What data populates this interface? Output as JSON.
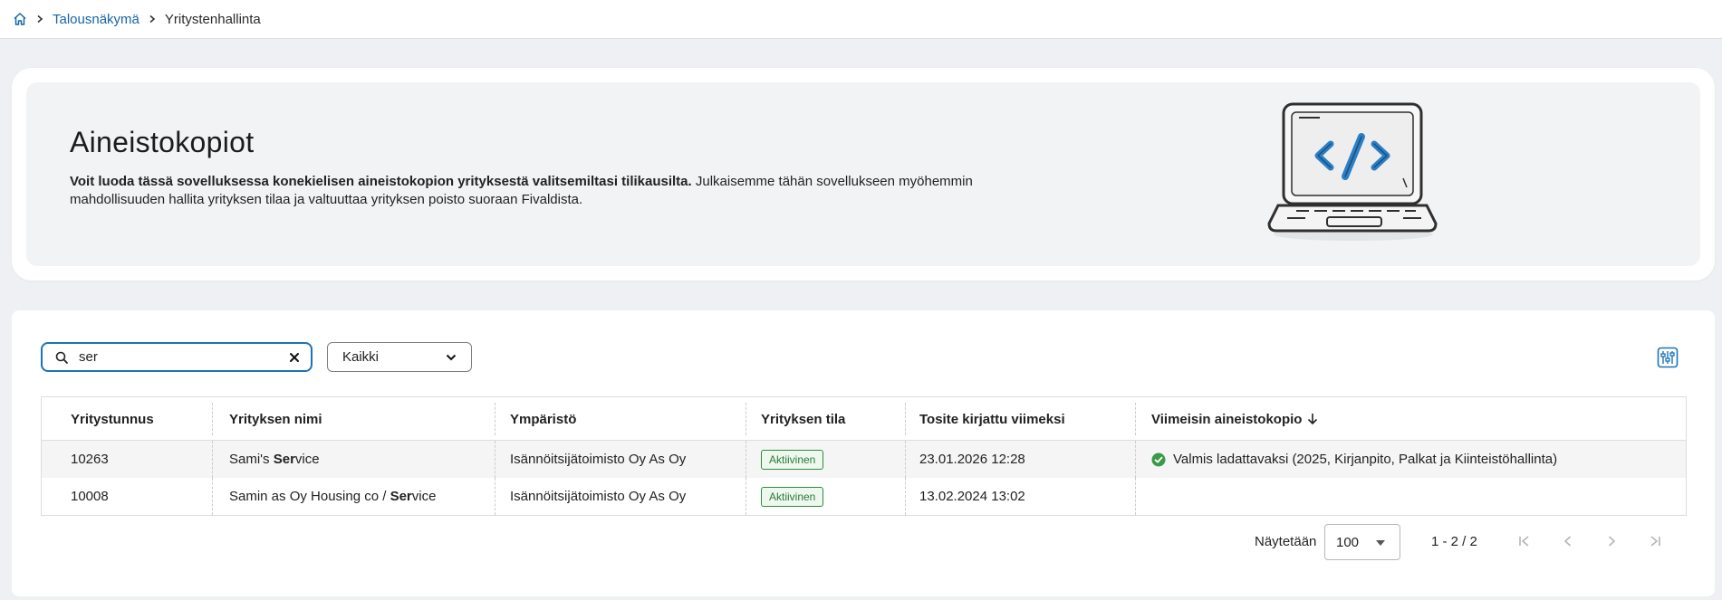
{
  "breadcrumb": {
    "home_icon": "home-icon",
    "items": [
      {
        "label": "Talousnäkymä"
      },
      {
        "label": "Yritystenhallinta"
      }
    ]
  },
  "hero": {
    "title": "Aineistokopiot",
    "description_bold": "Voit luoda tässä sovelluksessa konekielisen aineistokopion yrityksestä valitsemiltasi tilikausilta.",
    "description_rest": " Julkaisemme tähän sovellukseen myöhemmin mahdollisuuden hallita yrityksen tilaa ja valtuuttaa yrityksen poisto suoraan Fivaldista.",
    "illustration": "laptop-code-illustration"
  },
  "toolbar": {
    "search_value": "ser",
    "search_icon": "search-icon",
    "clear_icon": "close-icon",
    "filter_value": "Kaikki",
    "columns_icon": "column-settings-icon"
  },
  "table": {
    "columns": [
      {
        "label": "Yritystunnus"
      },
      {
        "label": "Yrityksen nimi"
      },
      {
        "label": "Ympäristö"
      },
      {
        "label": "Yrityksen tila"
      },
      {
        "label": "Tosite kirjattu viimeksi"
      },
      {
        "label": "Viimeisin aineistokopio"
      }
    ],
    "sorted_column": "Viimeisin aineistokopio",
    "sort_direction": "descending",
    "rows": [
      {
        "id": "10263",
        "name_pre": "Sami's ",
        "name_match": "Ser",
        "name_post": "vice",
        "environment": "Isännöitsijätoimisto Oy As Oy",
        "status": "Aktiivinen",
        "last_voucher": "23.01.2026 12:28",
        "latest_copy": "Valmis ladattavaksi (2025, Kirjanpito, Palkat ja Kiinteistöhallinta)"
      },
      {
        "id": "10008",
        "name_pre": "Samin as Oy Housing co / ",
        "name_match": "Ser",
        "name_post": "vice",
        "environment": "Isännöitsijätoimisto Oy As Oy",
        "status": "Aktiivinen",
        "last_voucher": "13.02.2024 13:02",
        "latest_copy": ""
      }
    ]
  },
  "pager": {
    "label": "Näytetään",
    "page_size": "100",
    "range": "1 - 2 / 2"
  },
  "colors": {
    "accent": "#1a73b8",
    "success": "#3a9a4a",
    "background": "#eff0f3"
  }
}
